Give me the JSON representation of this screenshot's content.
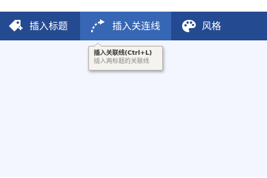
{
  "toolbar": {
    "items": [
      {
        "label": "插入标题",
        "icon": "tag-plus-icon",
        "active": false
      },
      {
        "label": "插入关连线",
        "icon": "curved-arrow-icon",
        "active": true
      },
      {
        "label": "风格",
        "icon": "palette-icon",
        "active": false
      }
    ]
  },
  "tooltip": {
    "title": "插入关联线(Ctrl+L)",
    "description": "插入两标题的关联线"
  },
  "colors": {
    "toolbar_bg": "#244a91",
    "toolbar_active": "#3666b4",
    "canvas_bg": "#f3f6ff",
    "tooltip_bg": "#f5f3ef"
  }
}
